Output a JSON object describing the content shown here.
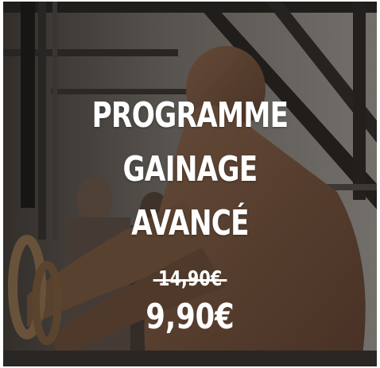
{
  "product": {
    "title_lines": [
      "PROGRAMME",
      "GAINAGE",
      "AVANCÉ"
    ],
    "old_price": "14,90€",
    "new_price": "9,90€"
  },
  "colors": {
    "text": "#ffffff",
    "overlay": "rgba(20,16,14,0.42)"
  },
  "image": {
    "subject": "gym-rings-athlete-photo"
  }
}
